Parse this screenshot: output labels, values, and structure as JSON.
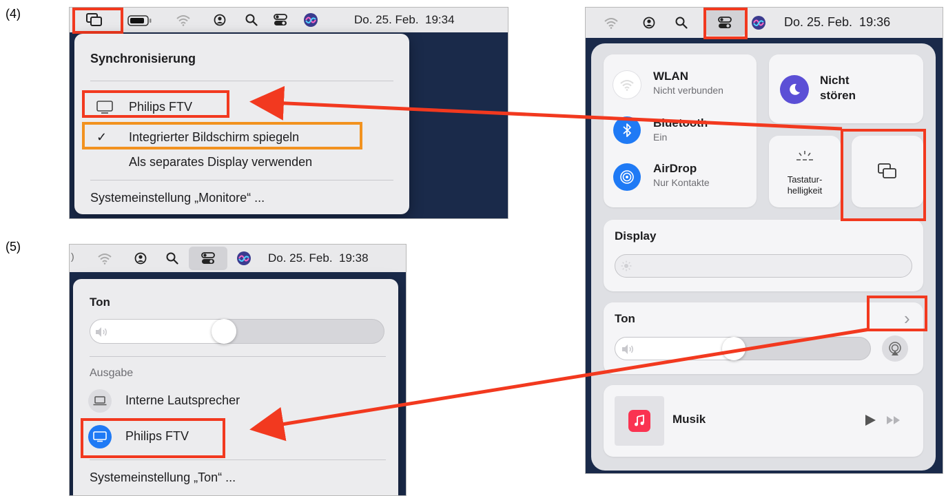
{
  "step4": {
    "label": "(4)",
    "datetime": "Do. 25. Feb.  19:34",
    "menu": {
      "title": "Synchronisierung",
      "device": "Philips FTV",
      "checkmark": "✓",
      "mirror": "Integrierter Bildschirm spiegeln",
      "separate": "Als separates Display verwenden",
      "settings": "Systemeinstellung „Monitore“ ..."
    }
  },
  "step5": {
    "label": "(5)",
    "datetime": "Do. 25. Feb.  19:38",
    "menu": {
      "sound_title": "Ton",
      "output_title": "Ausgabe",
      "internal": "Interne Lautsprecher",
      "device": "Philips FTV",
      "settings": "Systemeinstellung „Ton“ ..."
    }
  },
  "control_center": {
    "datetime": "Do. 25. Feb.  19:36",
    "wlan_title": "WLAN",
    "wlan_status": "Nicht verbunden",
    "bluetooth_title": "Bluetooth",
    "bluetooth_status": "Ein",
    "airdrop_title": "AirDrop",
    "airdrop_status": "Nur Kontakte",
    "dnd_line1": "Nicht",
    "dnd_line2": "stören",
    "keyboard_line1": "Tastatur-",
    "keyboard_line2": "helligkeit",
    "display_title": "Display",
    "sound_title": "Ton",
    "chevron": "›",
    "music_title": "Musik"
  },
  "colors": {
    "highlight": "#f2391f",
    "secondary_highlight": "#f2921f",
    "accent_blue": "#1f7af5",
    "dnd_purple": "#5b4fd6",
    "music_red": "#fa3351"
  },
  "levels": {
    "step5_volume": 0.45,
    "cc_volume": 0.46,
    "cc_brightness": 0.0
  }
}
